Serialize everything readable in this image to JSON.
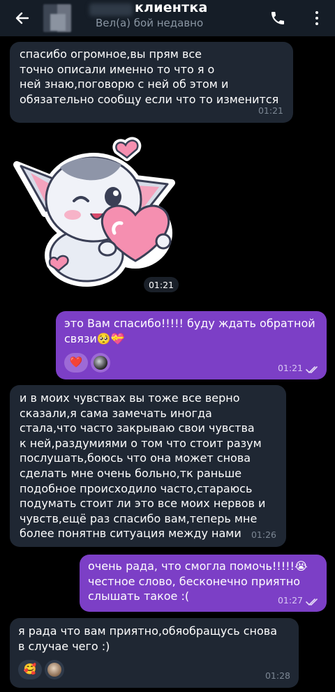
{
  "header": {
    "contact_name": "клиентка",
    "status": "Вел(а) бой недавно"
  },
  "messages": [
    {
      "text": "спасибо огромное,вы прям все\nточно описали именно то что я о\nней знаю,поговорю с ней об этом и\nобязательно сообщу если что то изменится",
      "time": "01:21",
      "direction": "incoming"
    },
    {
      "sticker": "cat-with-heart-sticker",
      "time": "01:21",
      "direction": "incoming"
    },
    {
      "text": "это Вам спасибо!!!!! буду ждать обратной\nсвязи🥺💝",
      "time": "01:21",
      "direction": "outgoing",
      "reactions": [
        "❤️",
        "avatar"
      ]
    },
    {
      "text": "и в моих чувствах вы тоже все верно\nсказали,я сама замечать иногда\nстала,что часто закрываю свои чувства\nк ней,раздумиями о том что стоит разум\nпослушать,боюсь что она может снова\nсделать мне очень больно,тк раньше\nподобное происходило часто,стараюсь\nподумать стоит ли это все моих нервов и\nчувств,ещё раз спасибо вам,теперь мне\nболее понятнв ситуация между нами",
      "time": "01:26",
      "direction": "incoming"
    },
    {
      "text": "очень рада, что смогла помочь!!!!!😭\nчестное слово, бесконечно приятно\nслышать такое :(",
      "time": "01:27",
      "direction": "outgoing"
    },
    {
      "text": "я рада что вам приятно,обяобращусь снова\nв случае чего :)",
      "time": "01:28",
      "direction": "incoming",
      "reactions": [
        "🥰",
        "avatar"
      ]
    }
  ],
  "colors": {
    "header_bg": "#151d27",
    "incoming_bubble": "#1f2733",
    "outgoing_bubble": "#7c3fc6",
    "background": "#000000"
  }
}
